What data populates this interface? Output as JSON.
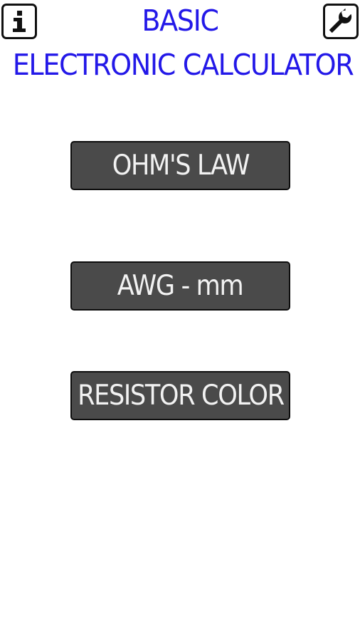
{
  "header": {
    "title_line1": "BASIC",
    "title_line2": "ELECTRONIC CALCULATOR",
    "info_icon": "info-icon",
    "settings_icon": "wrench-icon",
    "title_color": "#2318e8"
  },
  "menu": {
    "items": [
      {
        "label": "OHM'S LAW"
      },
      {
        "label": "AWG - mm"
      },
      {
        "label": "RESISTOR COLOR"
      }
    ],
    "button_color": "#4a4a4a",
    "text_color": "#f2f2f2"
  }
}
